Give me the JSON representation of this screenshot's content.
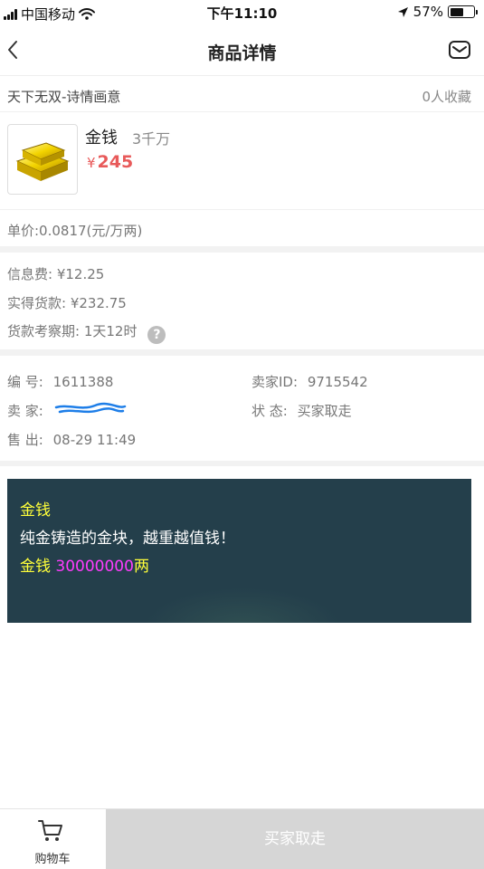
{
  "status_bar": {
    "carrier": "中国移动",
    "time": "下午11:10",
    "battery_percent": "57%",
    "battery_level": 0.57,
    "icons": [
      "signal-icon",
      "wifi-icon",
      "location-arrow-icon",
      "battery-icon"
    ]
  },
  "nav": {
    "title": "商品详情",
    "back_icon": "chevron-left-icon",
    "mail_icon": "mail-icon"
  },
  "server": {
    "name": "天下无双-诗情画意",
    "favorites": "0人收藏"
  },
  "product": {
    "name": "金钱",
    "amount": "3千万",
    "currency_symbol": "¥",
    "price": "245",
    "image_icon": "gold-bars-icon"
  },
  "unit_price": "单价:0.0817(元/万两)",
  "fees": {
    "info_fee": "信息费: ¥12.25",
    "net_payment": "实得货款: ¥232.75",
    "inspection_period": "货款考察期: 1天12时",
    "help_icon": "question-icon",
    "help_glyph": "?"
  },
  "details": {
    "id_label": "编 号:",
    "id_value": "1611388",
    "seller_id_label": "卖家ID:",
    "seller_id_value": "9715542",
    "seller_label": "卖 家:",
    "status_label": "状 态:",
    "status_value": "买家取走",
    "sold_label": "售 出:",
    "sold_value": "08-29 11:49"
  },
  "description": {
    "title": "金钱",
    "text": "纯金铸造的金块，越重越值钱！",
    "qty_label": "金钱",
    "qty_value": "30000000",
    "qty_unit": "两",
    "colors": {
      "background": "#243f4b",
      "highlight": "#ffff3a",
      "number": "#ff3cff"
    }
  },
  "bottom_bar": {
    "cart_label": "购物车",
    "cart_icon": "shopping-cart-icon",
    "action_label": "买家取走"
  },
  "colors": {
    "price": "#e85a5a",
    "action_disabled": "#d6d6d6"
  }
}
